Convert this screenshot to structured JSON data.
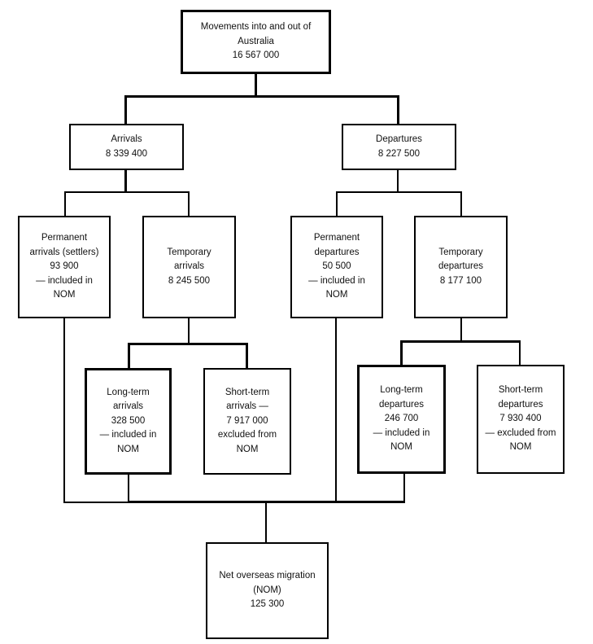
{
  "nodes": {
    "root": {
      "lines": [
        "Movements into and out of",
        "Australia",
        "16 567 000"
      ]
    },
    "arrivals": {
      "lines": [
        "Arrivals",
        "8 339 400"
      ]
    },
    "departures": {
      "lines": [
        "Departures",
        "8 227 500"
      ]
    },
    "permanent_arrivals": {
      "lines": [
        "Permanent",
        "arrivals (settlers)",
        "93 900",
        "— included in",
        "NOM"
      ]
    },
    "temporary_arrivals": {
      "lines": [
        "Temporary",
        "arrivals",
        "8 245 500"
      ]
    },
    "permanent_departures": {
      "lines": [
        "Permanent",
        "departures",
        "50 500",
        "— included in",
        "NOM"
      ]
    },
    "temporary_departures": {
      "lines": [
        "Temporary",
        "departures",
        "8 177 100"
      ]
    },
    "long_term_arrivals": {
      "lines": [
        "Long-term",
        "arrivals",
        "328 500",
        "— included in",
        "NOM"
      ]
    },
    "short_term_arrivals": {
      "lines": [
        "Short-term",
        "arrivals —",
        "7 917 000",
        "excluded from",
        "NOM"
      ]
    },
    "long_term_departures": {
      "lines": [
        "Long-term",
        "departures",
        "246 700",
        "— included in",
        "NOM"
      ]
    },
    "short_term_departures": {
      "lines": [
        "Short-term",
        "departures",
        "7 930 400",
        "— excluded from",
        "NOM"
      ]
    },
    "nom": {
      "lines": [
        "Net overseas migration",
        "(NOM)",
        "125 300"
      ]
    }
  },
  "edges": [
    [
      "root",
      "arrivals"
    ],
    [
      "root",
      "departures"
    ],
    [
      "arrivals",
      "permanent_arrivals"
    ],
    [
      "arrivals",
      "temporary_arrivals"
    ],
    [
      "departures",
      "permanent_departures"
    ],
    [
      "departures",
      "temporary_departures"
    ],
    [
      "temporary_arrivals",
      "long_term_arrivals"
    ],
    [
      "temporary_arrivals",
      "short_term_arrivals"
    ],
    [
      "temporary_departures",
      "long_term_departures"
    ],
    [
      "temporary_departures",
      "short_term_departures"
    ],
    [
      "permanent_arrivals",
      "nom"
    ],
    [
      "long_term_arrivals",
      "nom"
    ],
    [
      "permanent_departures",
      "nom"
    ],
    [
      "long_term_departures",
      "nom"
    ]
  ]
}
